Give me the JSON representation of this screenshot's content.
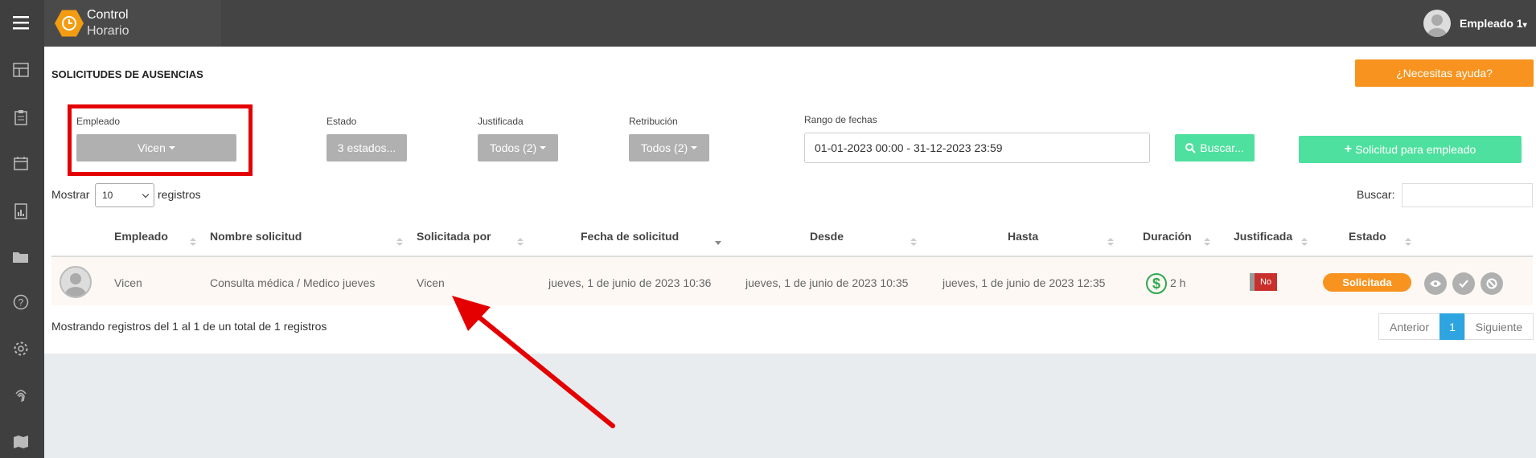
{
  "app": {
    "logo_line1": "Control",
    "logo_line2": "Horario",
    "user": "Empleado 1"
  },
  "sidebar": {
    "icons": [
      "menu-icon",
      "dashboard-icon",
      "clipboard-icon",
      "calendar-icon",
      "reports-icon",
      "folder-icon",
      "help-icon",
      "settings-icon",
      "fingerprint-icon",
      "map-icon"
    ]
  },
  "page": {
    "title": "SOLICITUDES DE AUSENCIAS",
    "help_button": "¿Necesitas ayuda?"
  },
  "filters": {
    "empleado_label": "Empleado",
    "empleado_value": "Vicen",
    "estado_label": "Estado",
    "estado_value": "3 estados...",
    "justificada_label": "Justificada",
    "justificada_value": "Todos (2)",
    "retribucion_label": "Retribución",
    "retribucion_value": "Todos (2)",
    "rango_label": "Rango de fechas",
    "rango_value": "01-01-2023 00:00 - 31-12-2023 23:59",
    "search_button": "Buscar...",
    "new_button": "Solicitud para empleado"
  },
  "table_controls": {
    "show_label": "Mostrar",
    "show_value": "10",
    "records_label": "registros",
    "search_label": "Buscar:"
  },
  "table": {
    "headers": [
      "Empleado",
      "Nombre solicitud",
      "Solicitada por",
      "Fecha de solicitud",
      "Desde",
      "Hasta",
      "Duración",
      "Justificada",
      "Estado"
    ],
    "rows": [
      {
        "empleado": "Vicen",
        "nombre": "Consulta médica / Medico jueves",
        "solicitada_por": "Vicen",
        "fecha": "jueves, 1 de junio de 2023 10:36",
        "desde": "jueves, 1 de junio de 2023 10:35",
        "hasta": "jueves, 1 de junio de 2023 12:35",
        "duracion": "2 h",
        "justificada": "No",
        "estado": "Solicitada"
      }
    ]
  },
  "footer": {
    "info": "Mostrando registros del 1 al 1 de un total de 1 registros",
    "prev": "Anterior",
    "page": "1",
    "next": "Siguiente"
  },
  "colors": {
    "accent_orange": "#f7931e",
    "accent_green": "#4ee09e",
    "highlight_red": "#e40000",
    "pager_blue": "#2ea5e0"
  }
}
